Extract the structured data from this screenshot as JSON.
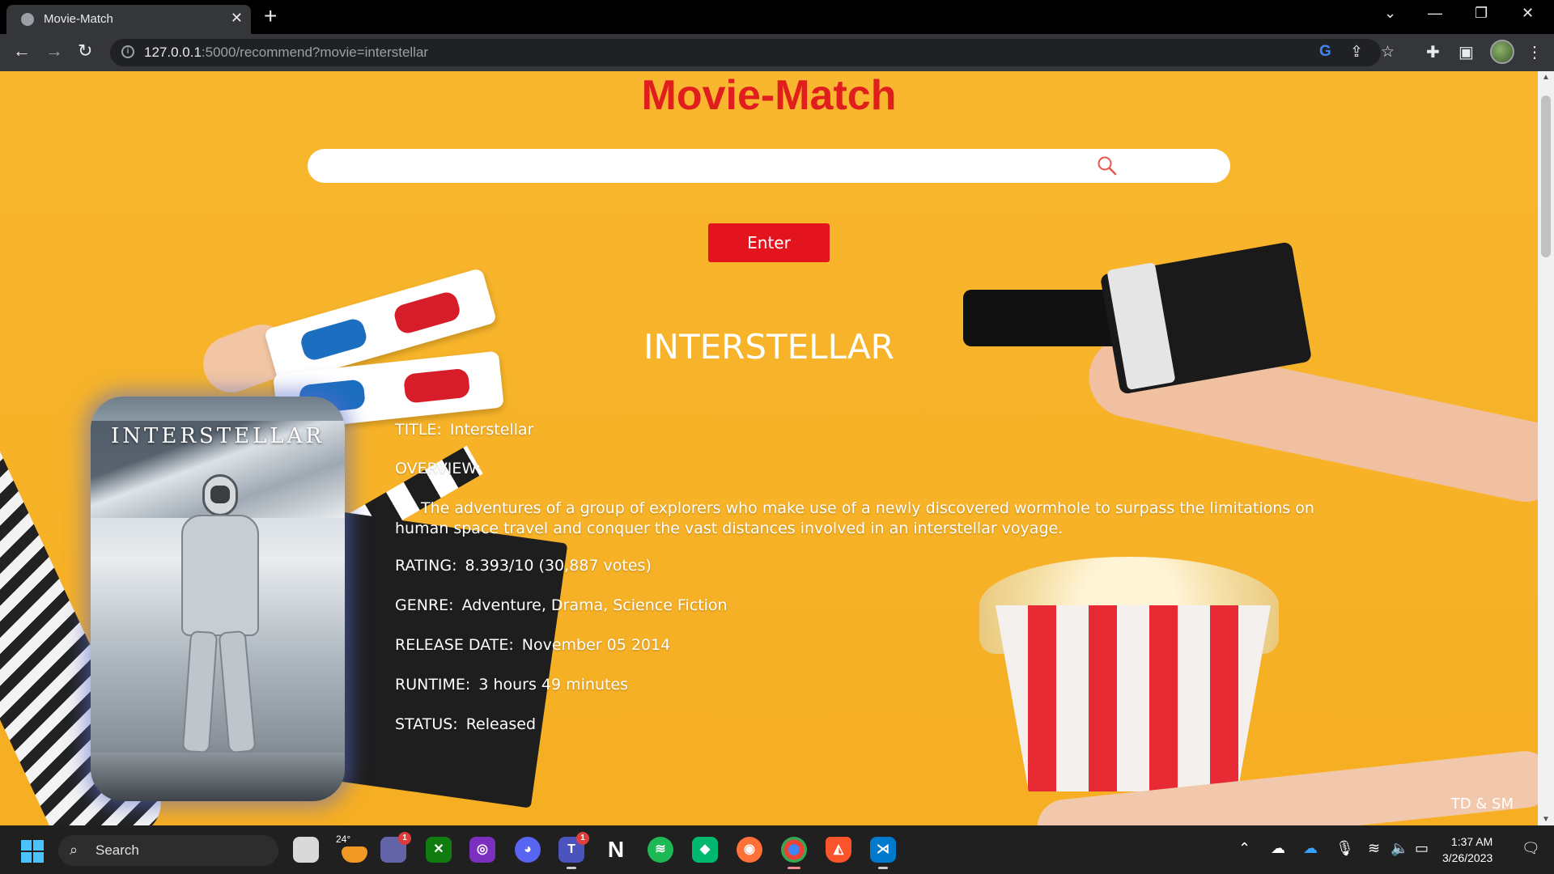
{
  "browser": {
    "tab_title": "Movie-Match",
    "tab_close": "✕",
    "new_tab": "+",
    "url_host": "127.0.0.1",
    "url_path": ":5000/recommend?movie=interstellar",
    "window_controls": [
      "⌄",
      "—",
      "❐",
      "✕"
    ]
  },
  "page": {
    "site_title": "Movie-Match",
    "search": {
      "value": "",
      "placeholder": ""
    },
    "enter_label": "Enter",
    "movie_heading": "INTERSTELLAR",
    "poster_title": "INTERSTELLAR",
    "details": {
      "title_label": "TITLE:",
      "title_value": "Interstellar",
      "overview_label": "OVERVIEW:",
      "overview_value": "The adventures of a group of explorers who make use of a newly discovered wormhole to surpass the limitations on human space travel and conquer the vast distances involved in an interstellar voyage.",
      "rating_label": "RATING:",
      "rating_value": "8.393/10 (30,887 votes)",
      "genre_label": "GENRE:",
      "genre_value": "Adventure, Drama, Science Fiction",
      "release_label": "RELEASE DATE:",
      "release_value": "November 05 2014",
      "runtime_label": "RUNTIME:",
      "runtime_value": "3 hours 49 minutes",
      "status_label": "STATUS:",
      "status_value": "Released"
    },
    "credit": "TD & SM"
  },
  "taskbar": {
    "search_label": "Search",
    "weather_temp": "24°",
    "teams_badge": "1",
    "chat_badge": "1",
    "time": "1:37 AM",
    "date": "3/26/2023"
  },
  "colors": {
    "page_bg": "#f7b42c",
    "title_red": "#e01e1e",
    "button_red": "#e3141e"
  }
}
